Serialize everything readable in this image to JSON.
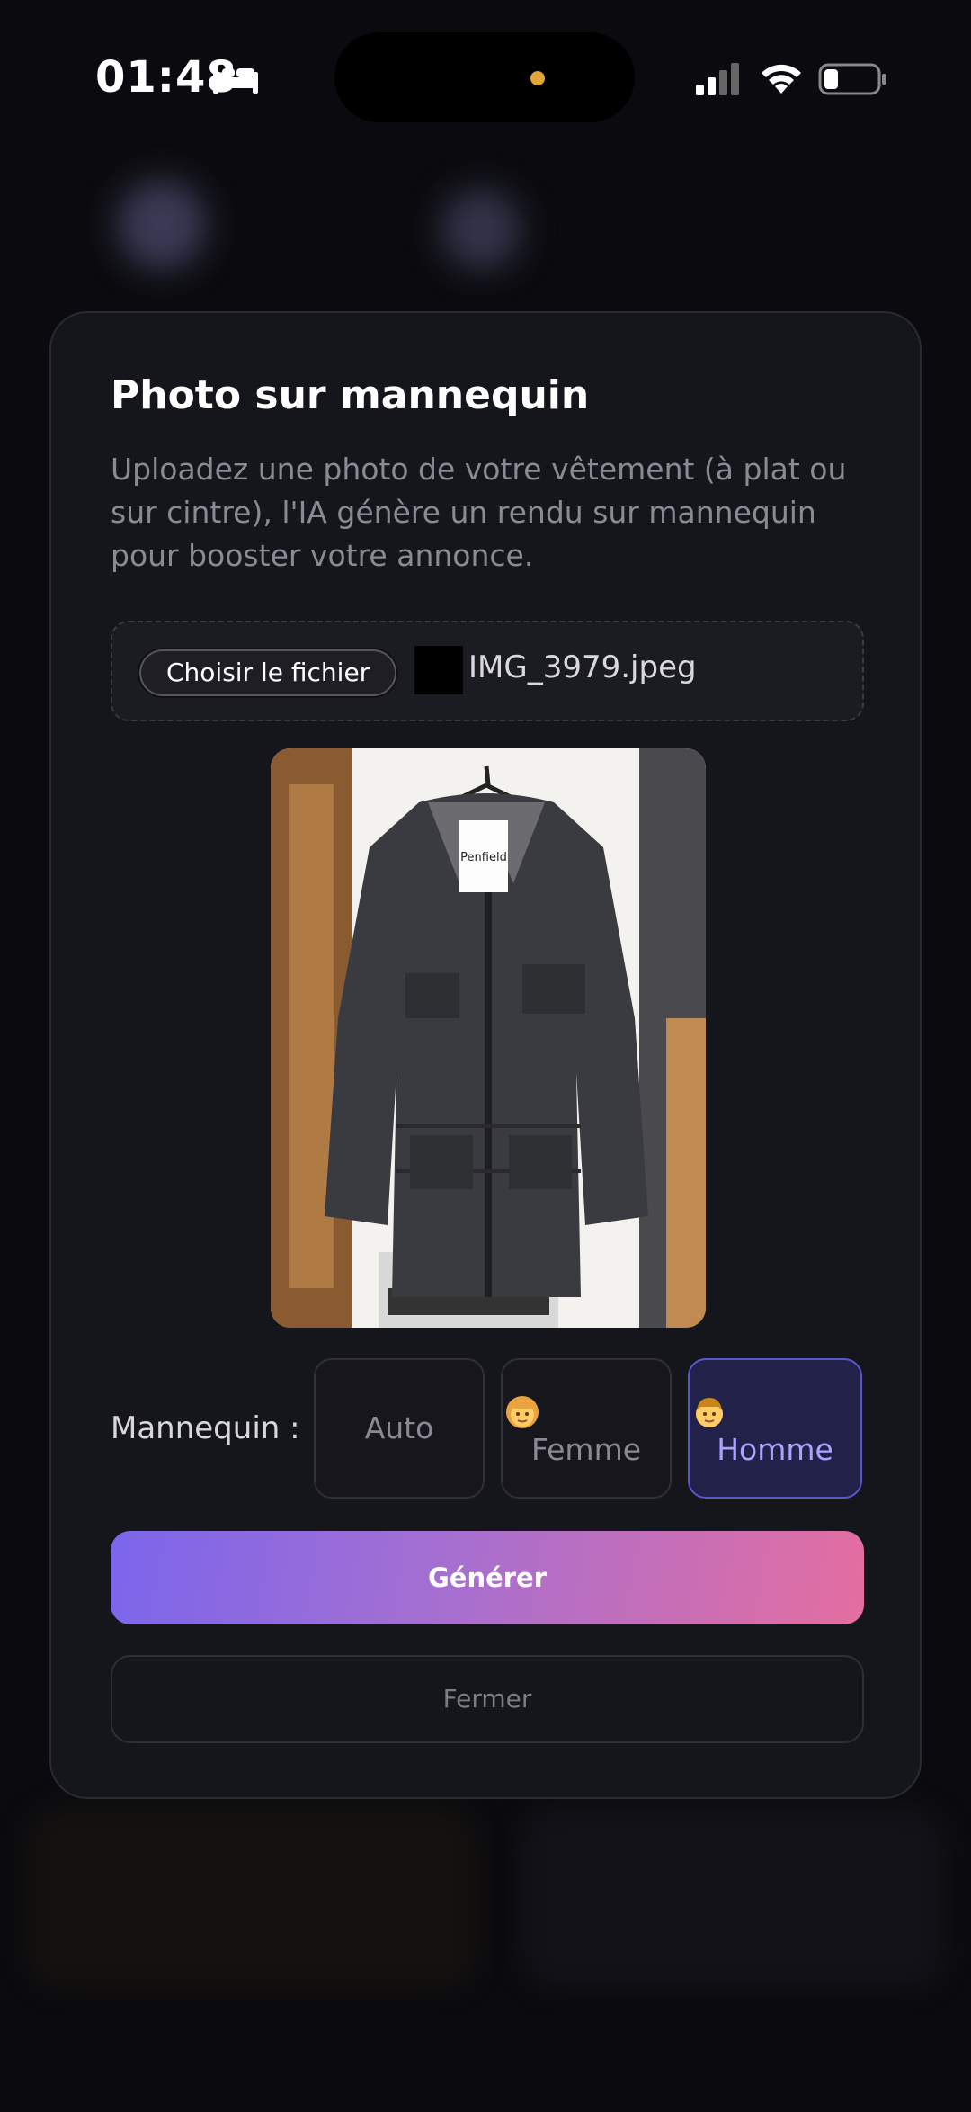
{
  "status_bar": {
    "time": "01:48"
  },
  "modal": {
    "title": "Photo sur mannequin",
    "description": "Uploadez une photo de votre vêtement (à plat ou sur cintre), l'IA génère un rendu sur mannequin pour booster votre annonce.",
    "file_input": {
      "button_label": "Choisir le fichier",
      "file_name": "IMG_3979.jpeg"
    },
    "preview_tag": "Penfield",
    "mannequin": {
      "label": "Mannequin :",
      "options": [
        {
          "label": "Auto",
          "emoji": ""
        },
        {
          "label": "Femme",
          "emoji": "👩"
        },
        {
          "label": "Homme",
          "emoji": "👨"
        }
      ],
      "selected": "Homme"
    },
    "generate_label": "Générer",
    "close_label": "Fermer"
  },
  "colors": {
    "accent_start": "#7b66ec",
    "accent_end": "#e46ea0",
    "selected_bg": "#22214a",
    "selected_text": "#a9a4ff"
  }
}
